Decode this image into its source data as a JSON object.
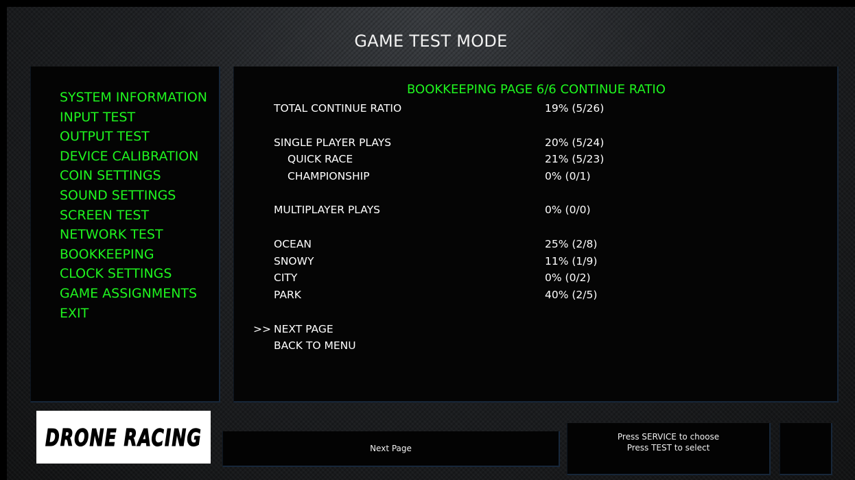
{
  "header": {
    "title": "GAME TEST MODE"
  },
  "sidebar": {
    "items": [
      {
        "label": "SYSTEM INFORMATION"
      },
      {
        "label": "INPUT TEST"
      },
      {
        "label": "OUTPUT TEST"
      },
      {
        "label": "DEVICE CALIBRATION"
      },
      {
        "label": "COIN SETTINGS"
      },
      {
        "label": "SOUND SETTINGS"
      },
      {
        "label": "SCREEN TEST"
      },
      {
        "label": "NETWORK TEST"
      },
      {
        "label": "BOOKKEEPING"
      },
      {
        "label": "CLOCK SETTINGS"
      },
      {
        "label": "GAME ASSIGNMENTS"
      },
      {
        "label": "EXIT"
      }
    ]
  },
  "main": {
    "heading": "BOOKKEEPING PAGE 6/6 CONTINUE RATIO",
    "rows": [
      {
        "label": "TOTAL CONTINUE RATIO",
        "value": "19% (5/26)"
      },
      {
        "label": "SINGLE PLAYER PLAYS",
        "value": "20% (5/24)"
      },
      {
        "label": "QUICK RACE",
        "value": "21% (5/23)"
      },
      {
        "label": "CHAMPIONSHIP",
        "value": "0% (0/1)"
      },
      {
        "label": "MULTIPLAYER PLAYS",
        "value": "0% (0/0)"
      },
      {
        "label": "OCEAN",
        "value": "25% (2/8)"
      },
      {
        "label": "SNOWY",
        "value": "11% (1/9)"
      },
      {
        "label": "CITY",
        "value": "0% (0/2)"
      },
      {
        "label": "PARK",
        "value": "40% (2/5)"
      }
    ],
    "cursor": ">>",
    "actions": {
      "next_page": "NEXT PAGE",
      "back_to_menu": "BACK TO MENU"
    }
  },
  "logo": {
    "text": "DRONE RACING"
  },
  "footer": {
    "next_label": "Next Page",
    "help_line1": "Press SERVICE to choose",
    "help_line2": "Press TEST to select"
  },
  "colors": {
    "menu_green": "#1ff51f",
    "panel_border": "#17273a"
  }
}
